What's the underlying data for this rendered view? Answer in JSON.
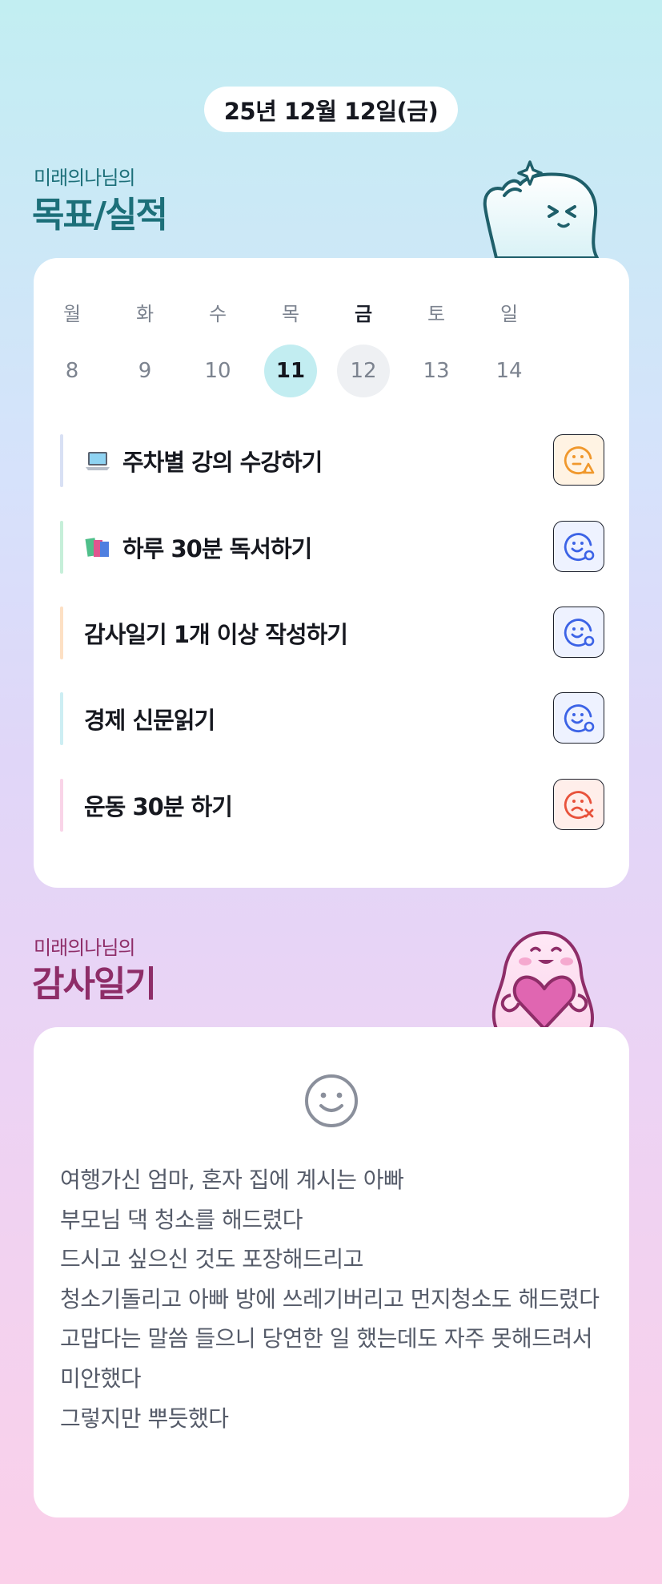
{
  "date_label": "25년 12월 12일(금)",
  "goals_section": {
    "subtitle": "미래의나님의",
    "title": "목표/실적"
  },
  "week": {
    "weekdays": [
      "월",
      "화",
      "수",
      "목",
      "금",
      "토",
      "일"
    ],
    "days": [
      "8",
      "9",
      "10",
      "11",
      "12",
      "13",
      "14"
    ],
    "current_day": "11",
    "selected_day": "12"
  },
  "goals": [
    {
      "icon": "laptop-icon",
      "label": "주차별 강의 수강하기",
      "status": "triangle",
      "accent": "#d8e0f4"
    },
    {
      "icon": "books-icon",
      "label": "하루 30분 독서하기",
      "status": "circle",
      "accent": "#c6efd9"
    },
    {
      "icon": "",
      "label": "감사일기 1개 이상 작성하기",
      "status": "circle",
      "accent": "#fde0c4"
    },
    {
      "icon": "",
      "label": "경제 신문읽기",
      "status": "circle",
      "accent": "#cdeef3"
    },
    {
      "icon": "",
      "label": "운동 30분 하기",
      "status": "x",
      "accent": "#f9d4e8"
    }
  ],
  "diary_section": {
    "subtitle": "미래의나님의",
    "title": "감사일기"
  },
  "diary": {
    "mood_icon": "smile-face-icon",
    "lines": [
      "여행가신 엄마, 혼자 집에 계시는 아빠",
      "부모님 댁 청소를 해드렸다",
      "드시고 싶으신 것도 포장해드리고",
      "청소기돌리고 아빠 방에 쓰레기버리고 먼지청소도 해드렸다",
      "고맙다는 말씀 들으니 당연한 일 했는데도 자주 못해드려서 미안했다",
      "그렇지만 뿌듯했다"
    ]
  },
  "colors": {
    "teal_title": "#1c6f79",
    "plum_title": "#8e2d68",
    "today_circle": "#c2edf1",
    "status_triangle": "#f0982c",
    "status_circle": "#3c63e6",
    "status_x": "#e8523b"
  }
}
